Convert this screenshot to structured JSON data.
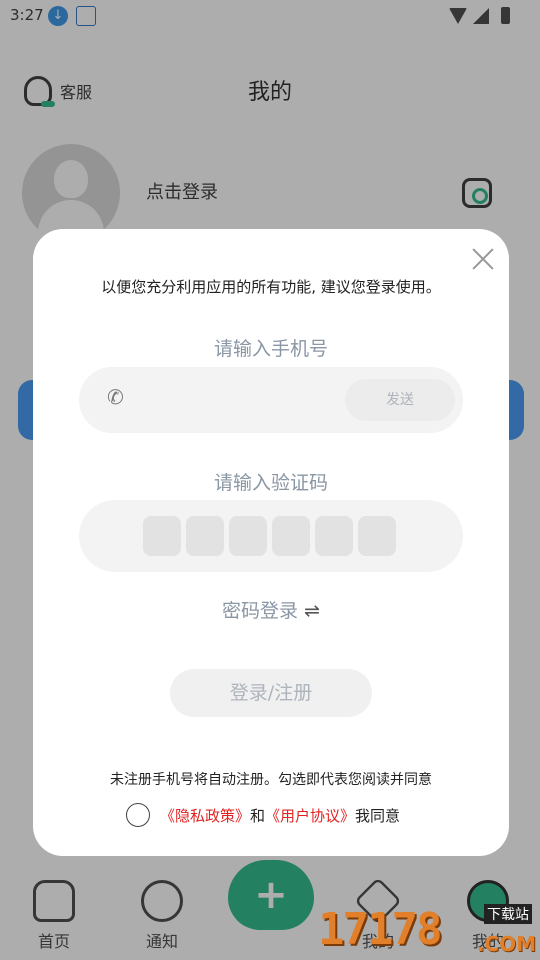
{
  "status_bar": {
    "time": "3:27"
  },
  "header": {
    "customer_service": "客服",
    "title": "我的"
  },
  "profile": {
    "login_prompt": "点击登录"
  },
  "bottom_nav": {
    "home": "首页",
    "notice": "通知",
    "mine_partial": "我的",
    "me": "我的",
    "add_icon": "plus-icon"
  },
  "modal": {
    "intro": "以便您充分利用应用的所有功能, 建议您登录使用。",
    "phone_label": "请输入手机号",
    "phone_placeholder": "",
    "send_label": "发送",
    "code_label": "请输入验证码",
    "code_cells": 6,
    "password_switch": "密码登录",
    "swap_glyph": "⇌",
    "login_button": "登录/注册",
    "notice": "未注册手机号将自动注册。勾选即代表您阅读并同意",
    "privacy_policy": "《隐私政策》",
    "and": "和",
    "user_agreement": "《用户协议》",
    "agree_suffix": "我同意"
  },
  "watermark": {
    "digits": "17178",
    "top_text": "下载站",
    "suffix": ".COM"
  },
  "colors": {
    "accent": "#12b27c",
    "link_red": "#e02424",
    "label_gray": "#8a96a4"
  }
}
